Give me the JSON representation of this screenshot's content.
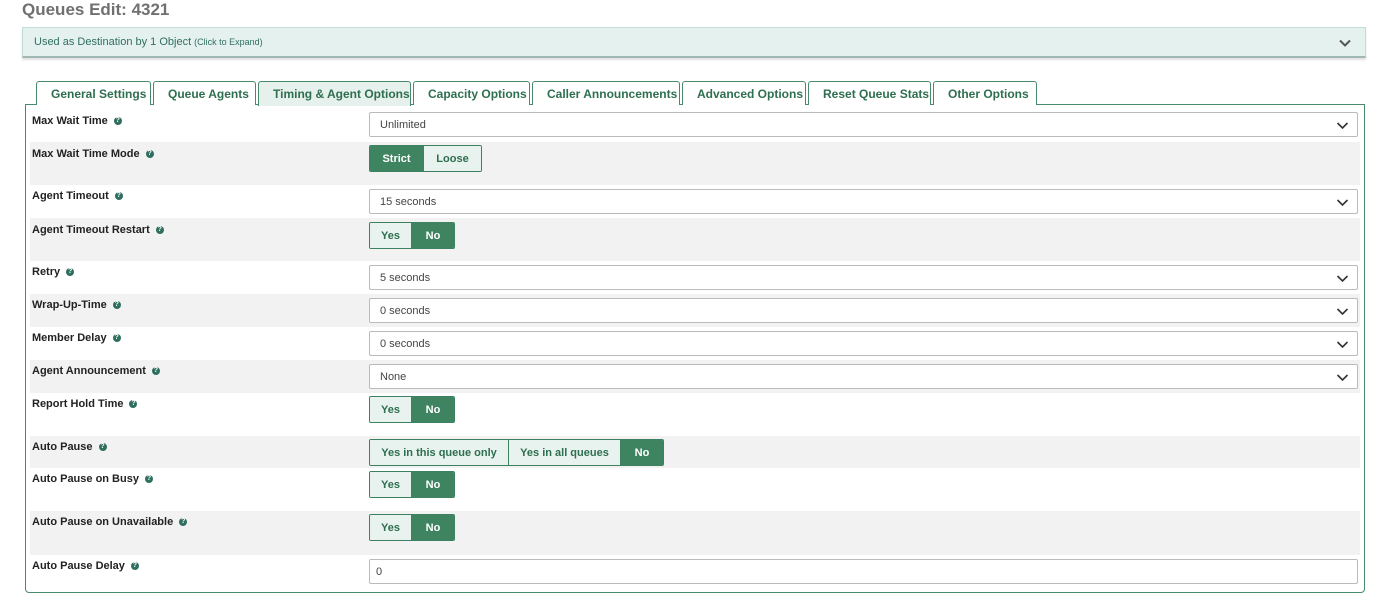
{
  "page": {
    "title": "Queues Edit: 4321",
    "destination": {
      "text": "Used as Destination by 1 Object",
      "hint": "(Click to Expand)",
      "icon": "chevron-down-icon"
    }
  },
  "tabs": [
    "General Settings",
    "Queue Agents",
    "Timing & Agent Options",
    "Capacity Options",
    "Caller Announcements",
    "Advanced Options",
    "Reset Queue Stats",
    "Other Options"
  ],
  "active_tab": "Timing & Agent Options",
  "help_glyph": "?",
  "fields": {
    "max_wait_time": {
      "label": "Max Wait Time",
      "value": "Unlimited"
    },
    "max_wait_time_mode": {
      "label": "Max Wait Time Mode",
      "options": [
        "Strict",
        "Loose"
      ],
      "selected": "Strict"
    },
    "agent_timeout": {
      "label": "Agent Timeout",
      "value": "15 seconds"
    },
    "agent_timeout_restart": {
      "label": "Agent Timeout Restart",
      "options": [
        "Yes",
        "No"
      ],
      "selected": "No"
    },
    "retry": {
      "label": "Retry",
      "value": "5 seconds"
    },
    "wrap_up_time": {
      "label": "Wrap-Up-Time",
      "value": "0 seconds"
    },
    "member_delay": {
      "label": "Member Delay",
      "value": "0 seconds"
    },
    "agent_announcement": {
      "label": "Agent Announcement",
      "value": "None"
    },
    "report_hold_time": {
      "label": "Report Hold Time",
      "options": [
        "Yes",
        "No"
      ],
      "selected": "No"
    },
    "auto_pause": {
      "label": "Auto Pause",
      "options": [
        "Yes in this queue only",
        "Yes in all queues",
        "No"
      ],
      "selected": "No"
    },
    "auto_pause_busy": {
      "label": "Auto Pause on Busy",
      "options": [
        "Yes",
        "No"
      ],
      "selected": "No"
    },
    "auto_pause_unavailable": {
      "label": "Auto Pause on Unavailable",
      "options": [
        "Yes",
        "No"
      ],
      "selected": "No"
    },
    "auto_pause_delay": {
      "label": "Auto Pause Delay",
      "value": "0"
    }
  },
  "colors": {
    "accent": "#3f8461",
    "accent_light": "#e8f2ee",
    "banner": "#e5f1ef"
  }
}
